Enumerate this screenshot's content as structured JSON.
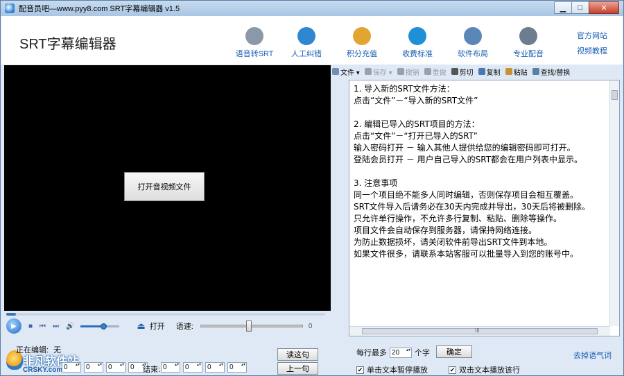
{
  "window": {
    "title": "配音员吧—www.pyy8.com SRT字幕编辑器 v1.5",
    "minimize": "▁",
    "maximize": "□",
    "close": "✕"
  },
  "header": {
    "app_title": "SRT字幕编辑器",
    "tools": [
      {
        "label": "语音转SRT",
        "icon": "robot-icon",
        "color": "#8a99a8"
      },
      {
        "label": "人工纠错",
        "icon": "user-icon",
        "color": "#2f86d1"
      },
      {
        "label": "积分充值",
        "icon": "coins-icon",
        "color": "#e2a531"
      },
      {
        "label": "收费标准",
        "icon": "yen-icon",
        "color": "#1f8fd6"
      },
      {
        "label": "软件布局",
        "icon": "layout-icon",
        "color": "#5b86b8"
      },
      {
        "label": "专业配音",
        "icon": "microphone-icon",
        "color": "#6c7d8f"
      }
    ],
    "links": [
      "官方网站",
      "视频教程"
    ]
  },
  "video": {
    "open_button": "打开音视频文件"
  },
  "player": {
    "play": "▶",
    "stop": "■",
    "prev": "⏮",
    "next": "⏭",
    "volume": "🔊",
    "eject": "⏏",
    "open_label": "打开",
    "speed_label": "语速:",
    "speed_value": "0",
    "speed_level": 0.47,
    "volume_level": 0.62
  },
  "bottom_left": {
    "editing_label": "正在编辑:",
    "editing_value": "无",
    "end_label": "结束:",
    "start_values": [
      "0",
      "0",
      "0",
      "0"
    ],
    "end_values": [
      "0",
      "0",
      "0",
      "0"
    ],
    "read_button": "读这句",
    "prev_button": "上一句"
  },
  "watermark": {
    "text_cn": "非凡软件站",
    "text_en": "CRSKY.com"
  },
  "editor_toolbar": [
    {
      "label": "文件 ▾",
      "icon": "file-icon",
      "color": "#6f8fb3",
      "enabled": true
    },
    {
      "label": "保存 ▾",
      "icon": "save-icon",
      "color": "#9aa0a8",
      "enabled": false
    },
    {
      "label": "撤销",
      "icon": "undo-icon",
      "color": "#9aa0a8",
      "enabled": false
    },
    {
      "label": "重做",
      "icon": "redo-icon",
      "color": "#9aa0a8",
      "enabled": false
    },
    {
      "label": "剪切",
      "icon": "cut-icon",
      "color": "#555",
      "enabled": true
    },
    {
      "label": "复制",
      "icon": "copy-icon",
      "color": "#4a79b0",
      "enabled": true
    },
    {
      "label": "粘贴",
      "icon": "paste-icon",
      "color": "#c7922f",
      "enabled": true
    },
    {
      "label": "查找/替换",
      "icon": "find-icon",
      "color": "#5b7fa5",
      "enabled": true
    }
  ],
  "editor": {
    "text": "1. 导入新的SRT文件方法：\n点击“文件”－“导入新的SRT文件”\n\n2. 编辑已导入的SRT项目的方法：\n点击“文件”－“打开已导入的SRT”\n输入密码打开 － 输入其他人提供给您的编辑密码即可打开。\n登陆会员打开 － 用户自己导入的SRT都会在用户列表中显示。\n\n3. 注意事项\n同一个项目绝不能多人同时编辑，否则保存项目会相互覆盖。\nSRT文件导入后请务必在30天内完成并导出，30天后将被删除。\n只允许单行操作，不允许多行复制、粘贴、删除等操作。\n项目文件会自动保存到服务器，请保持网络连接。\n为防止数据损坏，请关闭软件前导出SRT文件到本地。\n如果文件很多，请联系本站客服可以批量导入到您的账号中。",
    "hscroll_grip": "III"
  },
  "bottom_right": {
    "max_chars_label": "每行最多",
    "max_chars_value": "20",
    "max_chars_unit": "个字",
    "confirm_button": "确定",
    "remove_filler_link": "去掉语气词",
    "single_click_label": "单击文本暂停播放",
    "double_click_label": "双击文本播放该行",
    "single_click_checked": true,
    "double_click_checked": true,
    "check_mark": "✔"
  }
}
